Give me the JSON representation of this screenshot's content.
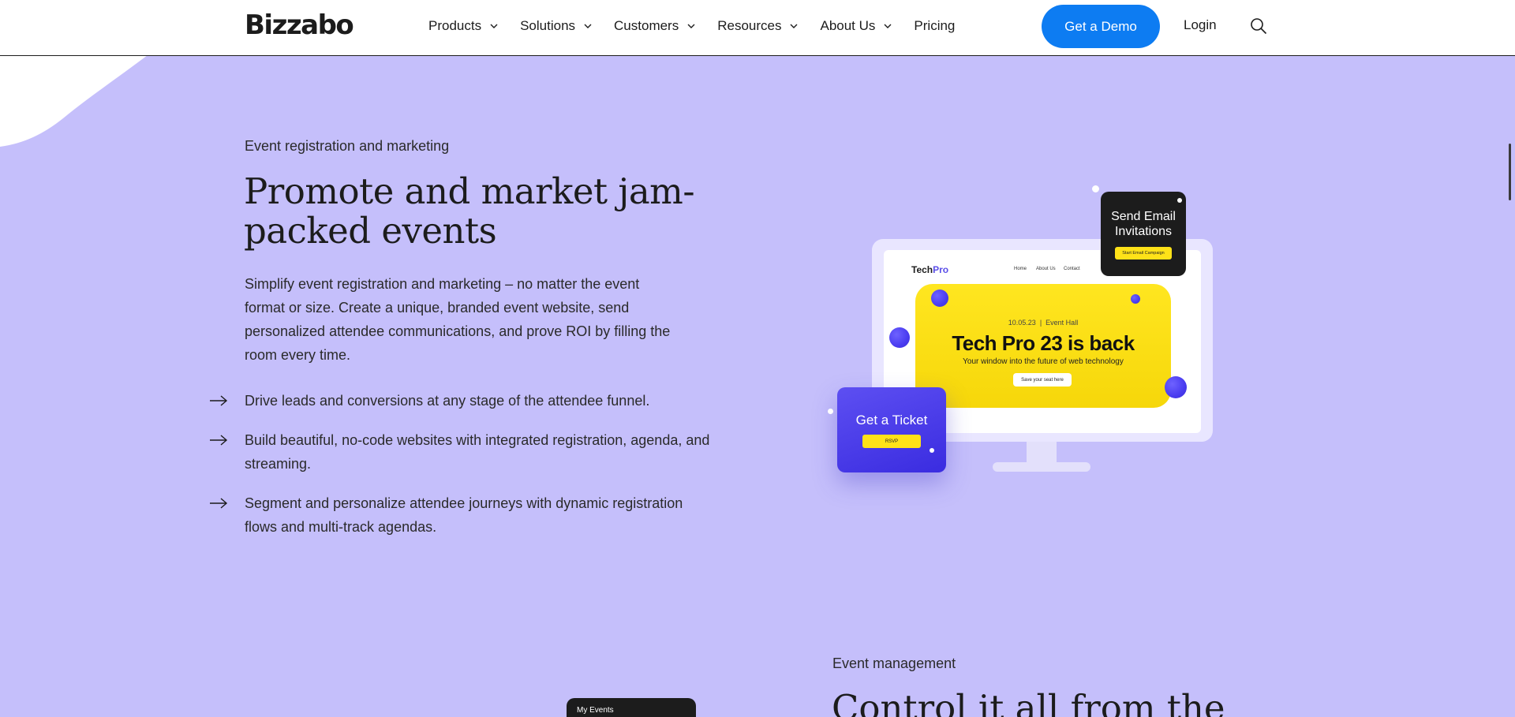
{
  "header": {
    "logo": "Bizzabo",
    "nav": [
      {
        "label": "Products",
        "has_dropdown": true
      },
      {
        "label": "Solutions",
        "has_dropdown": true
      },
      {
        "label": "Customers",
        "has_dropdown": true
      },
      {
        "label": "Resources",
        "has_dropdown": true
      },
      {
        "label": "About Us",
        "has_dropdown": true
      },
      {
        "label": "Pricing",
        "has_dropdown": false
      }
    ],
    "cta_label": "Get a Demo",
    "login_label": "Login",
    "search_icon": "search-icon"
  },
  "section": {
    "eyebrow": "Event registration and marketing",
    "headline": "Promote and market jam-packed events",
    "description": "Simplify event registration and marketing – no matter the event format or size. Create a unique, branded event website, send personalized attendee communications, and prove ROI by filling the room every time.",
    "bullets": [
      "Drive leads and conversions at any stage of the attendee funnel.",
      "Build beautiful, no-code websites with integrated registration, agenda, and streaming.",
      "Segment and personalize attendee journeys with dynamic registration flows and multi-track agendas."
    ]
  },
  "illustration": {
    "site_logo_a": "Tech",
    "site_logo_b": "Pro",
    "site_nav": [
      "Home",
      "About Us",
      "Contact"
    ],
    "event_date": "10.05.23",
    "event_venue": "Event Hall",
    "event_title": "Tech Pro 23 is back",
    "event_subtitle": "Your window into the future of web technology",
    "event_button": "Save your seat here",
    "email_card_title": "Send Email Invitations",
    "email_card_button": "Start Email Campaign",
    "ticket_card_title": "Get a Ticket",
    "ticket_card_button": "RSVP"
  },
  "next_section": {
    "eyebrow": "Event management",
    "headline": "Control it all from the",
    "card_label": "My Events"
  },
  "colors": {
    "background": "#c5bffb",
    "cta": "#0d7cf2",
    "accent_yellow": "#ffe218",
    "accent_purple": "#4a3cf0"
  }
}
